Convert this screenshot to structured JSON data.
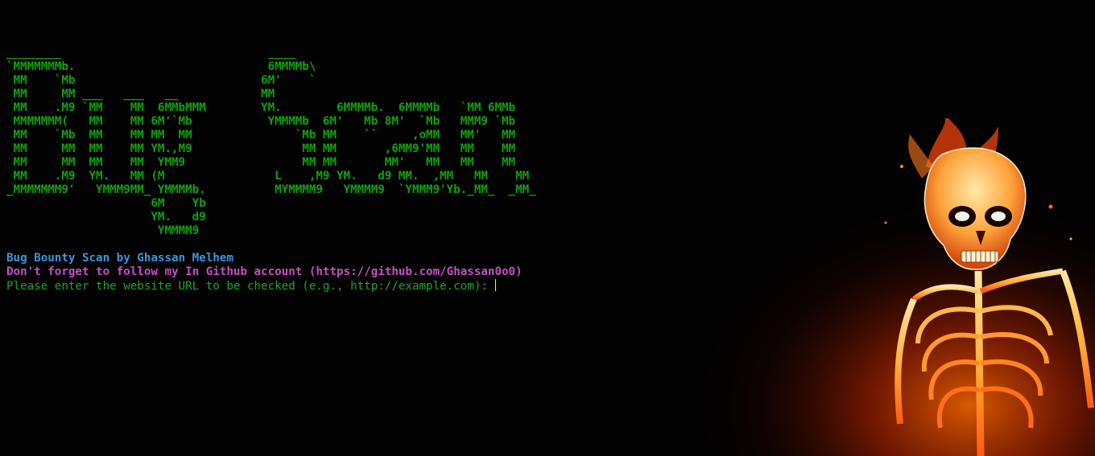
{
  "terminal": {
    "banner_lines": [
      "________                              ____",
      "`MMMMMMMb.                            6MMMMb\\",
      " MM    `Mb                           6M'    `",
      " MM     MM ___   ___   __            MM",
      " MM    .M9 `MM    MM  6MMbMMM        YM.        6MMMMb.  6MMMMb   `MM 6MMb",
      " MMMMMMM(   MM    MM 6M'`Mb           YMMMMb  6M'   Mb 8M'  `Mb   MMM9 `Mb",
      " MM    `Mb  MM    MM MM  MM               `Mb MM    ``     ,oMM   MM'   MM",
      " MM     MM  MM    MM YM.,M9                MM MM       ,6MM9'MM   MM    MM",
      " MM     MM  MM    MM  YMM9                 MM MM       MM'   MM   MM    MM",
      " MM    .M9  YM.   MM (M                L    ,M9 YM.   d9 MM.  ,MM   MM    MM",
      "_MMMMMMM9'   YMMM9MM_ YMMMMb.          MYMMMM9   YMMMM9  `YMMM9'Yb._MM_  _MM_",
      "                     6M    Yb",
      "                     YM.   d9",
      "                      YMMMM9"
    ],
    "credit": "Bug Bounty Scan by Ghassan Melhem",
    "github_note": "Don't forget to follow my In Github account (https://github.com/Ghassan0o0)",
    "prompt": "Please enter the website URL to be checked (e.g., http://example.com): ",
    "input_value": ""
  },
  "colors": {
    "background": "#020202",
    "banner": "#13a10e",
    "credit": "#3a96dd",
    "github_note": "#c450c4",
    "prompt": "#22a32a"
  },
  "wallpaper": {
    "icon": "flaming-skeleton-art"
  }
}
